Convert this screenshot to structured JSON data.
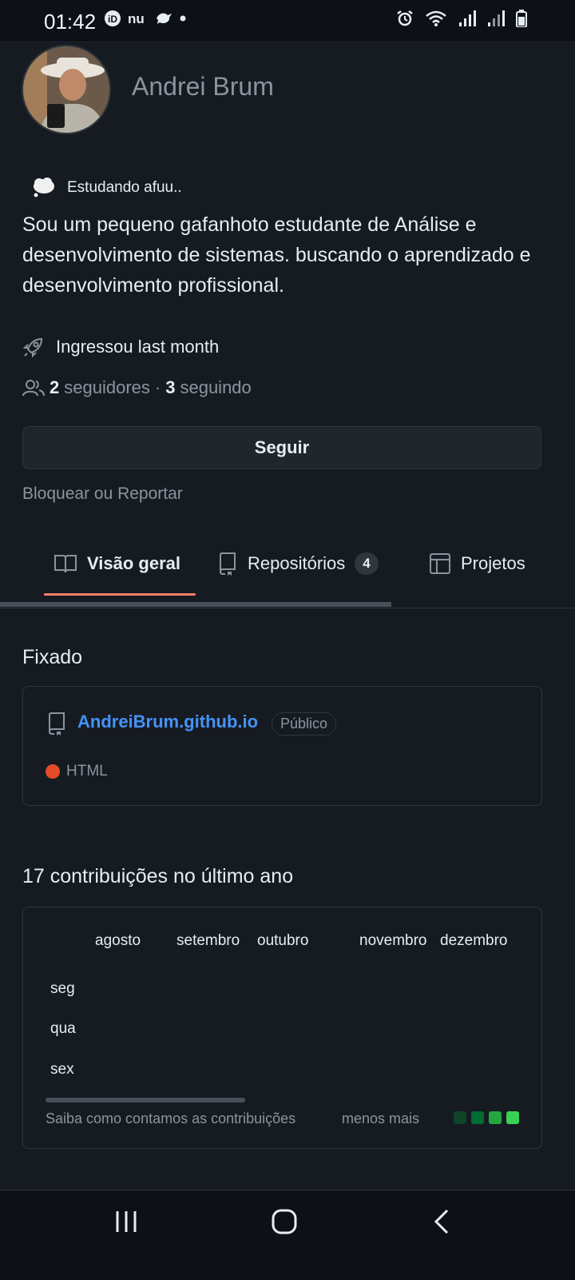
{
  "status_bar": {
    "time": "01:42",
    "left_icons": [
      "id-icon",
      "nu-icon",
      "bird-icon",
      "dot"
    ],
    "right_icons": [
      "alarm-icon",
      "wifi-icon",
      "signal-icon",
      "signal-icon",
      "battery-icon"
    ]
  },
  "profile": {
    "name": "Andrei Brum",
    "status_text": "Estudando afuu..",
    "bio": "Sou um pequeno gafanhoto estudante de Análise e desenvolvimento de sistemas. buscando o aprendizado e desenvolvimento profissional.",
    "joined": "Ingressou last month",
    "followers_count": "2",
    "followers_label": "seguidores",
    "separator": "·",
    "following_count": "3",
    "following_label": "seguindo",
    "follow_button": "Seguir",
    "block_link": "Bloquear ou Reportar"
  },
  "tabs": [
    {
      "label": "Visão geral",
      "icon": "book-icon",
      "active": true
    },
    {
      "label": "Repositórios",
      "icon": "repo-icon",
      "count": "4"
    },
    {
      "label": "Projetos",
      "icon": "table-icon"
    }
  ],
  "pinned": {
    "heading": "Fixado",
    "repo_name": "AndreiBrum.github.io",
    "visibility": "Público",
    "language": "HTML",
    "language_color": "#e34c26"
  },
  "contributions": {
    "heading": "17 contribuições no último ano",
    "months": [
      "agosto",
      "setembro",
      "outubro",
      "novembro",
      "dezembro"
    ],
    "days": [
      "seg",
      "qua",
      "sex"
    ],
    "learn_link": "Saiba como contamos as contribuições",
    "legend_less": "menos",
    "legend_more": "mais",
    "legend_colors": [
      "#0e4429",
      "#006d32",
      "#26a641",
      "#39d353"
    ]
  },
  "colors": {
    "background": "#161b22",
    "accent": "#f78166",
    "link": "#4493f8"
  }
}
